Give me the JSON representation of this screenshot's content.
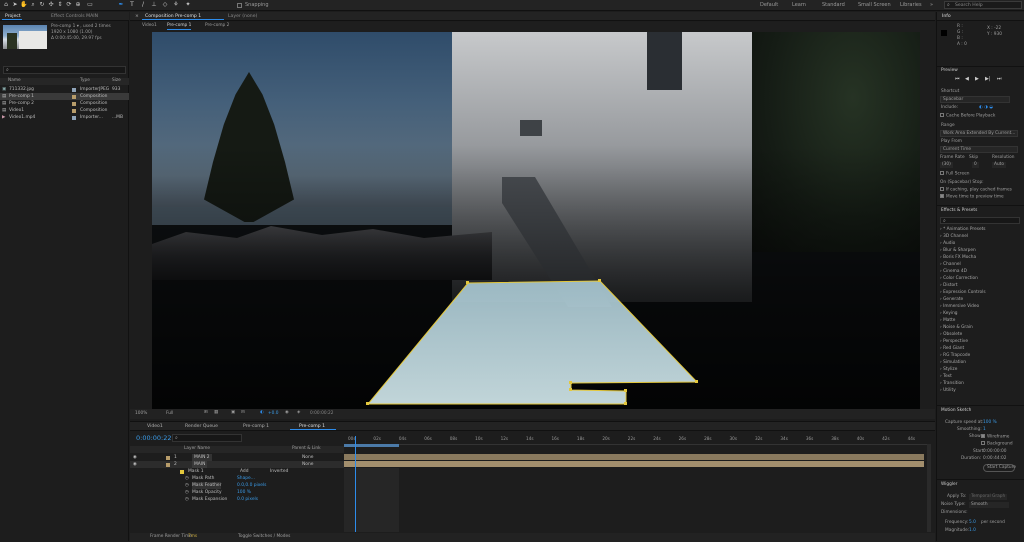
{
  "toolbar": {
    "snapping_label": "Snapping",
    "workspaces": [
      "Default",
      "Learn",
      "Standard",
      "Small Screen",
      "Libraries"
    ],
    "search_placeholder": "Search Help"
  },
  "project": {
    "tab_label": "Project",
    "tab_effect_controls": "Effect Controls MAIN",
    "thumb_info_line1": "Pre-comp 1 ▾ , used 2 times",
    "thumb_info_line2": "1920 x 1080 (1.00)",
    "thumb_info_line3": "Δ 0:00:45:00, 29.97 fps",
    "search_placeholder": "⌕",
    "col_name": "Name",
    "col_type": "Type",
    "col_size": "Size",
    "items": [
      {
        "name": "711332.jpg",
        "type": "ImporterJPEG",
        "size": "933"
      },
      {
        "name": "Pre-comp 1",
        "type": "Composition",
        "size": ""
      },
      {
        "name": "Pre-comp 2",
        "type": "Composition",
        "size": ""
      },
      {
        "name": "Video1",
        "type": "Composition",
        "size": ""
      },
      {
        "name": "Video1.mp4",
        "type": "Importer...",
        "size": "...MB"
      }
    ],
    "bpc_label": "8 bpc"
  },
  "composition": {
    "tab_label": "Composition Pre-comp 1",
    "layer_tab": "Layer (none)",
    "breadcrumbs": [
      "Video1",
      "Pre-comp 1",
      "Pre-comp 2"
    ],
    "zoom": "100%",
    "resolution": "Full",
    "exposure": "+0.0",
    "timecode": "0:00:00:22"
  },
  "timeline": {
    "tabs": [
      "Video1",
      "Render Queue",
      "Pre-comp 1",
      "Pre-comp 1"
    ],
    "timecode": "0:00:00:22",
    "search_placeholder": "⌕",
    "col_layer_name": "Layer Name",
    "col_parent": "Parent & Link",
    "layers": [
      {
        "num": "1",
        "name": "MAIN 2",
        "parent": "None"
      },
      {
        "num": "2",
        "name": "MAIN",
        "parent": "None"
      }
    ],
    "mask_name": "Mask 1",
    "mask_mode": "Add",
    "mask_inverted": "Inverted",
    "mask_props": [
      {
        "label": "Mask Path",
        "value": "Shape..."
      },
      {
        "label": "Mask Feather",
        "value": "0.0,0.0 pixels"
      },
      {
        "label": "Mask Opacity",
        "value": "100 %"
      },
      {
        "label": "Mask Expansion",
        "value": "0.0 pixels"
      }
    ],
    "ruler_ticks": [
      "00s",
      "02s",
      "04s",
      "06s",
      "08s",
      "10s",
      "12s",
      "14s",
      "16s",
      "18s",
      "20s",
      "22s",
      "24s",
      "26s",
      "28s",
      "30s",
      "32s",
      "34s",
      "36s",
      "38s",
      "40s",
      "42s",
      "44s"
    ],
    "frame_render_label": "Frame Render Time",
    "frame_render_value": "7ms",
    "toggle_label": "Toggle Switches / Modes"
  },
  "right": {
    "info_label": "Info",
    "info_r": "R :",
    "info_g": "G :",
    "info_b": "B :",
    "info_a": "A : 0",
    "info_x": "X : -22",
    "info_y": "Y : 930",
    "preview_label": "Preview",
    "shortcut_label": "Shortcut",
    "shortcut_value": "Spacebar",
    "include_label": "Include:",
    "cache_label": "Cache Before Playback",
    "range_label": "Range",
    "range_value": "Work Area Extended By Current...",
    "play_from_label": "Play From",
    "play_from_value": "Current Time",
    "frame_rate_label": "Frame Rate",
    "skip_label": "Skip",
    "resolution_label": "Resolution",
    "frame_rate_value": "(30)",
    "skip_value": "0",
    "resolution_value": "Auto",
    "full_screen": "Full Screen",
    "on_stop_label": "On (Spacebar) Stop:",
    "if_caching": "If caching, play cached frames",
    "move_time": "Move time to preview time",
    "effects_label": "Effects & Presets",
    "effects_search": "⌕",
    "effects_items": [
      "* Animation Presets",
      "3D Channel",
      "Audio",
      "Blur & Sharpen",
      "Boris FX Mocha",
      "Channel",
      "Cinema 4D",
      "Color Correction",
      "Distort",
      "Expression Controls",
      "Generate",
      "Immersive Video",
      "Keying",
      "Matte",
      "Noise & Grain",
      "Obsolete",
      "Perspective",
      "Red Giant",
      "RG Trapcode",
      "Simulation",
      "Stylize",
      "Text",
      "Transition",
      "Utility"
    ],
    "motion_sketch_label": "Motion Sketch",
    "capture_speed_label": "Capture speed at:",
    "capture_speed_value": "100 %",
    "smoothing_label": "Smoothing:",
    "smoothing_value": "1",
    "show_label": "Show:",
    "wireframe_label": "Wireframe",
    "background_label": "Background",
    "start_label": "Start:",
    "start_value": "0:00:00:00",
    "duration_label": "Duration:",
    "duration_value": "0:00:44:02",
    "start_capture": "Start Capture",
    "wiggler_label": "Wiggler",
    "apply_to_label": "Apply To:",
    "apply_to_value": "Temporal Graph",
    "noise_type_label": "Noise Type:",
    "noise_type_value": "Smooth",
    "dimensions_label": "Dimensions:",
    "frequency_label": "Frequency:",
    "frequency_value": "5.0",
    "frequency_unit": "per second",
    "magnitude_label": "Magnitude:",
    "magnitude_value": "1.0"
  },
  "colors": {
    "accent_blue": "#2d8ceb",
    "mask_yellow": "#e4c83c",
    "label_tan": "#b79c6a"
  }
}
